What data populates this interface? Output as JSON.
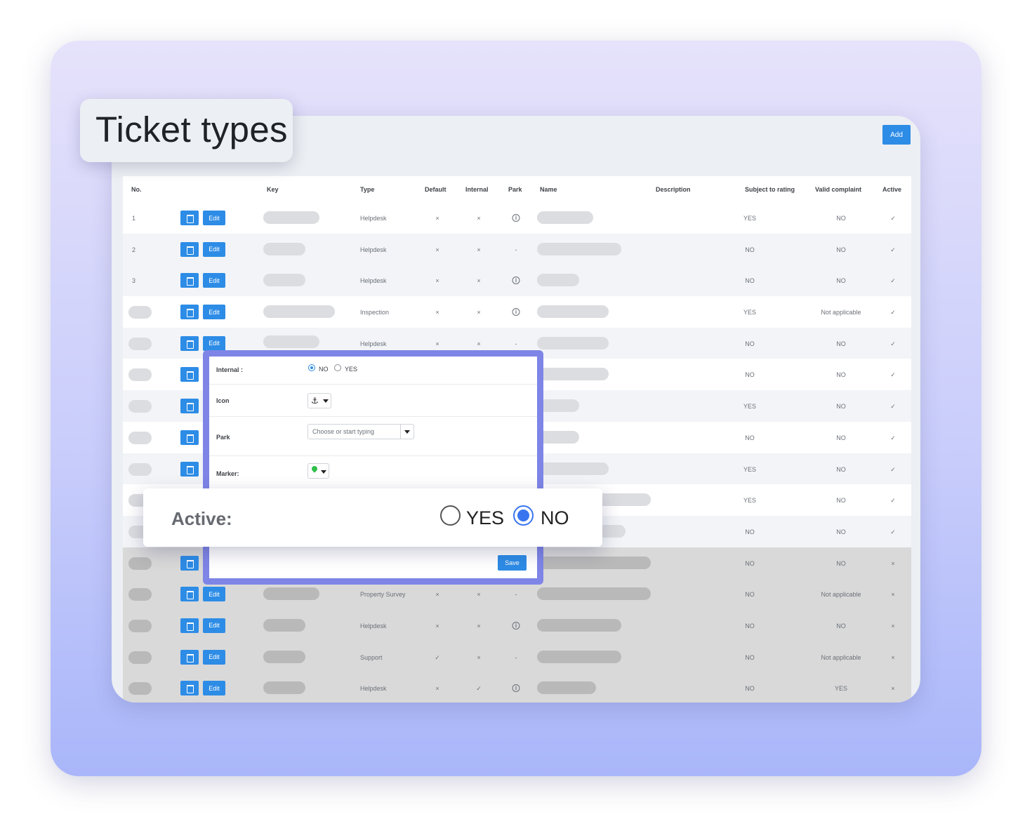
{
  "title": "Ticket types",
  "add_label": "Add",
  "headers": {
    "no": "No.",
    "key": "Key",
    "type": "Type",
    "default": "Default",
    "internal": "Internal",
    "park": "Park",
    "name": "Name",
    "description": "Description",
    "subject": "Subject to rating",
    "valid": "Valid complaint",
    "active": "Active"
  },
  "edit_label": "Edit",
  "rows": [
    {
      "no": "1",
      "type": "Helpdesk",
      "default": "×",
      "internal": "×",
      "park": "info",
      "subject": "YES",
      "valid": "NO",
      "active": "✓"
    },
    {
      "no": "2",
      "type": "Helpdesk",
      "default": "×",
      "internal": "×",
      "park": "-",
      "subject": "NO",
      "valid": "NO",
      "active": "✓"
    },
    {
      "no": "3",
      "type": "Helpdesk",
      "default": "×",
      "internal": "×",
      "park": "info",
      "subject": "NO",
      "valid": "NO",
      "active": "✓"
    },
    {
      "no": "",
      "type": "Inspection",
      "default": "×",
      "internal": "×",
      "park": "info",
      "subject": "YES",
      "valid": "Not applicable",
      "active": "✓"
    },
    {
      "no": "",
      "type": "Helpdesk",
      "default": "×",
      "internal": "×",
      "park": "-",
      "subject": "NO",
      "valid": "NO",
      "active": "✓"
    },
    {
      "no": "",
      "type": "",
      "default": "",
      "internal": "",
      "park": "",
      "subject": "NO",
      "valid": "NO",
      "active": "✓"
    },
    {
      "no": "",
      "type": "",
      "default": "",
      "internal": "",
      "park": "",
      "subject": "YES",
      "valid": "NO",
      "active": "✓"
    },
    {
      "no": "",
      "type": "",
      "default": "",
      "internal": "",
      "park": "",
      "subject": "NO",
      "valid": "NO",
      "active": "✓"
    },
    {
      "no": "",
      "type": "",
      "default": "",
      "internal": "",
      "park": "",
      "subject": "YES",
      "valid": "NO",
      "active": "✓"
    },
    {
      "no": "",
      "type": "",
      "default": "",
      "internal": "",
      "park": "",
      "subject": "YES",
      "valid": "NO",
      "active": "✓"
    },
    {
      "no": "",
      "type": "",
      "default": "",
      "internal": "",
      "park": "",
      "subject": "NO",
      "valid": "NO",
      "active": "✓"
    },
    {
      "no": "",
      "type": "",
      "default": "",
      "internal": "",
      "park": "",
      "subject": "NO",
      "valid": "NO",
      "active": "×"
    },
    {
      "no": "",
      "type": "Property Survey",
      "default": "×",
      "internal": "×",
      "park": "-",
      "subject": "NO",
      "valid": "Not applicable",
      "active": "×"
    },
    {
      "no": "",
      "type": "Helpdesk",
      "default": "×",
      "internal": "×",
      "park": "info",
      "subject": "NO",
      "valid": "NO",
      "active": "×"
    },
    {
      "no": "",
      "type": "Support",
      "default": "✓",
      "internal": "×",
      "park": "-",
      "subject": "NO",
      "valid": "Not applicable",
      "active": "×"
    },
    {
      "no": "",
      "type": "Helpdesk",
      "default": "×",
      "internal": "✓",
      "park": "info",
      "subject": "NO",
      "valid": "YES",
      "active": "×"
    }
  ],
  "modal": {
    "internal_label": "Internal :",
    "internal_no": "NO",
    "internal_yes": "YES",
    "icon_label": "Icon",
    "icon_glyph": "⚓",
    "park_label": "Park",
    "park_placeholder": "Choose or start typing",
    "marker_label": "Marker:",
    "save_label": "Save"
  },
  "active_card": {
    "label": "Active:",
    "yes": "YES",
    "no": "NO"
  },
  "colors": {
    "accent": "#2d8ce6",
    "modal_border": "#7e85e6",
    "radio_on": "#3a75f0"
  }
}
